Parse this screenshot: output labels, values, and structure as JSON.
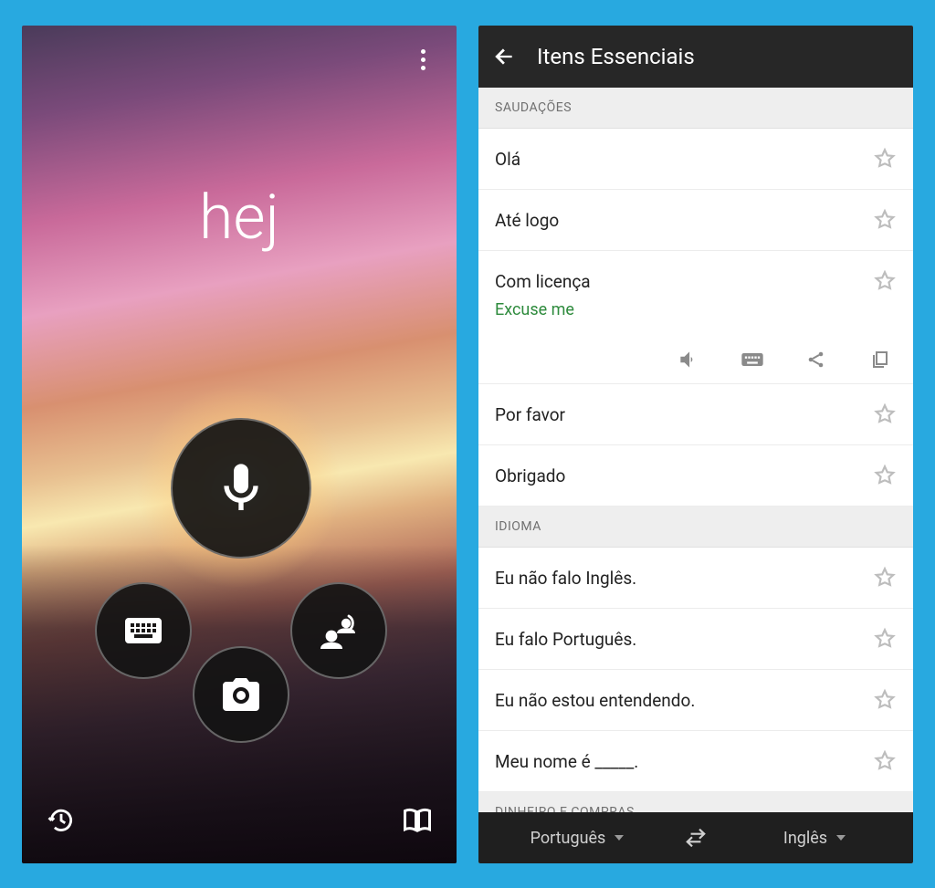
{
  "left": {
    "greeting": "hej"
  },
  "right": {
    "title": "Itens Essenciais",
    "sections": {
      "greetings": {
        "header": "SAUDAÇÕES",
        "items": {
          "ola": "Olá",
          "ate_logo": "Até logo",
          "com_licenca": "Com licença",
          "com_licenca_translation": "Excuse me",
          "por_favor": "Por favor",
          "obrigado": "Obrigado"
        }
      },
      "language": {
        "header": "IDIOMA",
        "items": {
          "nao_falo": "Eu não falo Inglês.",
          "falo": "Eu falo Português.",
          "nao_entendo": "Eu não estou entendendo.",
          "meu_nome": "Meu nome é _____."
        }
      },
      "money": {
        "header": "DINHEIRO E COMPRAS"
      }
    },
    "langbar": {
      "source": "Português",
      "target": "Inglês"
    }
  }
}
